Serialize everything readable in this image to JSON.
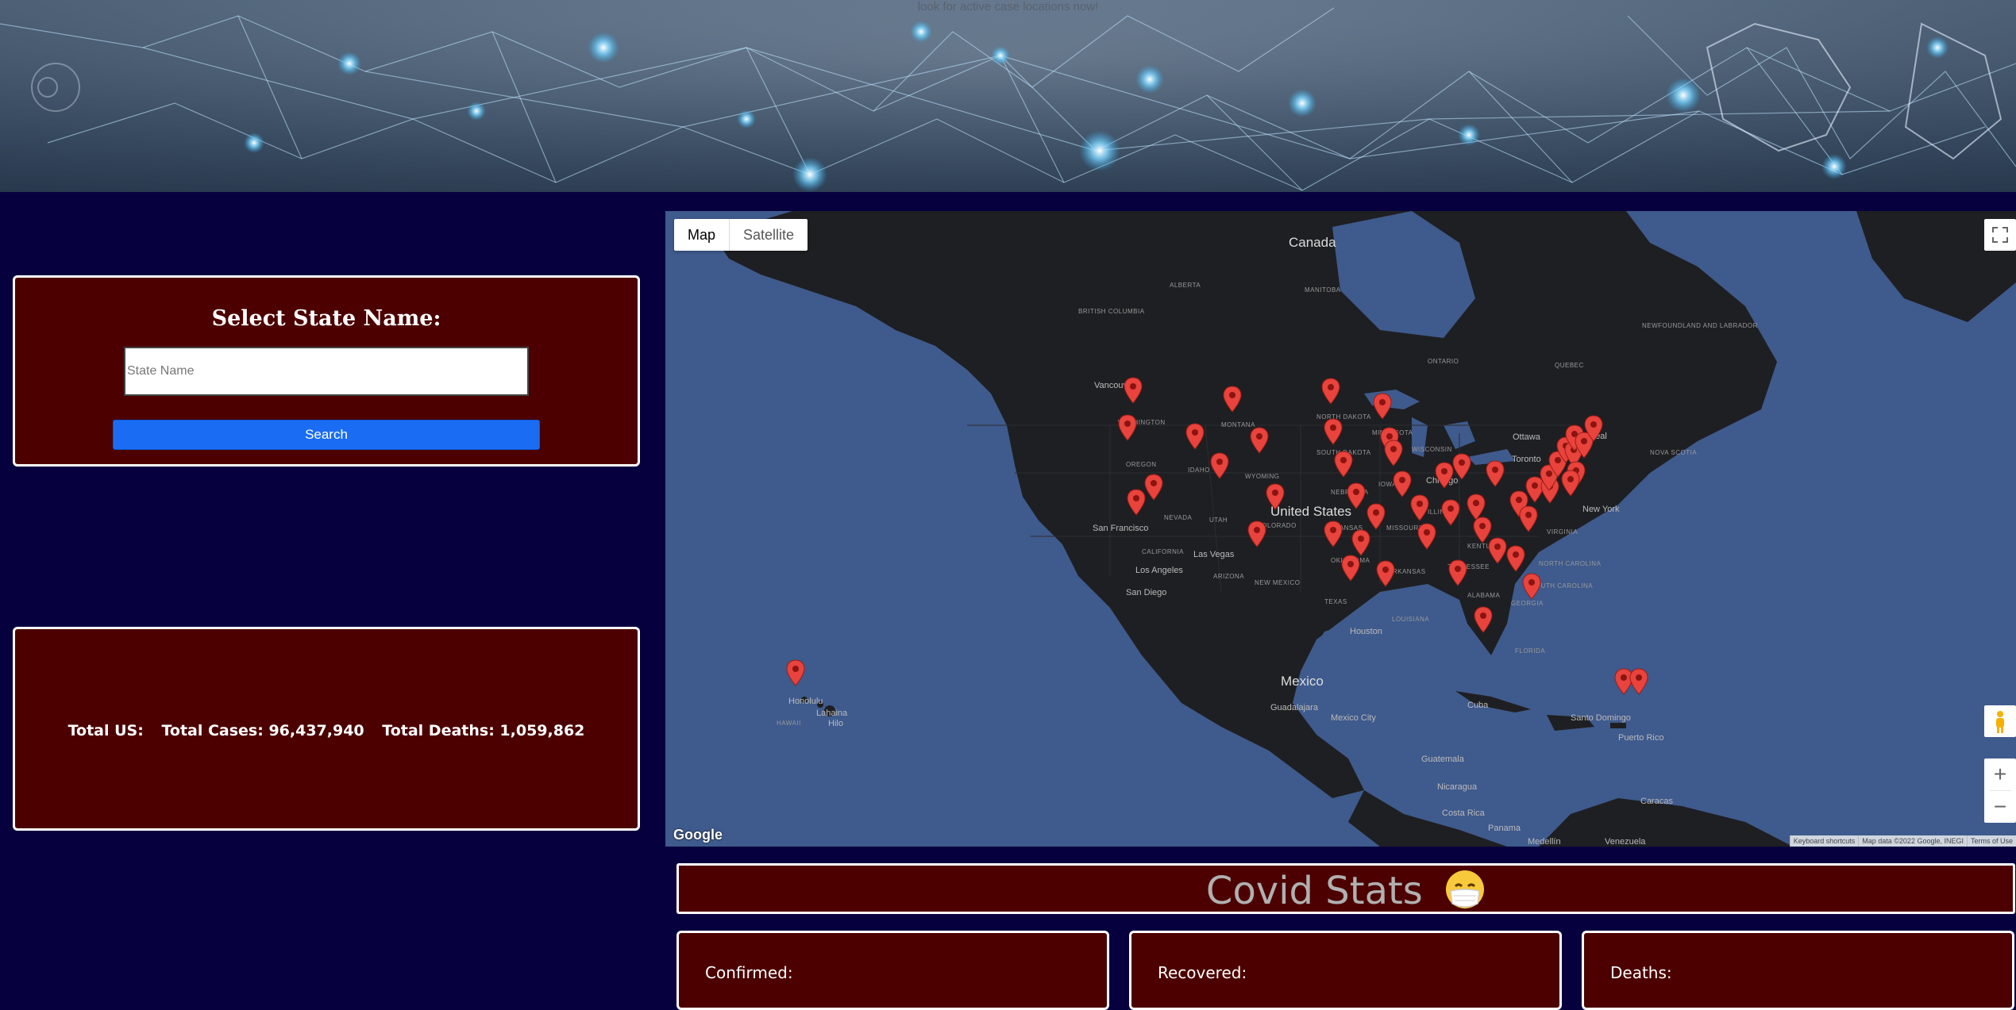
{
  "hero": {
    "tagline": "look for active case locations now!"
  },
  "search_panel": {
    "title": "Select State Name:",
    "input_placeholder": "State Name",
    "input_value": "",
    "search_label": "Search"
  },
  "totals": {
    "label": "Total US:",
    "cases": "Total Cases: 96,437,940",
    "deaths": "Total Deaths: 1,059,862"
  },
  "map": {
    "type_map": "Map",
    "type_satellite": "Satellite",
    "google": "Google",
    "attribution": [
      "Keyboard shortcuts",
      "Map data ©2022 Google, INEGI",
      "Terms of Use"
    ],
    "labels": {
      "canada": "Canada",
      "us": "United States",
      "mexico": "Mexico",
      "vancouver": "Vancouver",
      "sf": "San Francisco",
      "la": "Los Angeles",
      "sd": "San Diego",
      "lv": "Las Vegas",
      "houston": "Houston",
      "toronto": "Toronto",
      "ottawa": "Ottawa",
      "montreal": "Montreal",
      "ny": "New York",
      "chicago": "Chicago",
      "cuba": "Cuba",
      "pr": "Puerto Rico",
      "sto": "Santo Domingo",
      "guatemala": "Guatemala",
      "nicaragua": "Nicaragua",
      "costa": "Costa Rica",
      "panama": "Panama",
      "caracas": "Caracas",
      "venezuela": "Venezuela",
      "medellin": "Medellín",
      "guadalajara": "Guadalajara",
      "mexcity": "Mexico City",
      "honolulu": "Honolulu",
      "lahaina": "Lahaina",
      "hilo": "Hilo",
      "hawaii": "HAWAII",
      "alberta": "ALBERTA",
      "manitoba": "MANITOBA",
      "ontario": "ONTARIO",
      "quebec": "QUEBEC",
      "bc": "BRITISH COLUMBIA",
      "washington": "WASHINGTON",
      "oregon": "OREGON",
      "idaho": "IDAHO",
      "montana": "MONTANA",
      "wyoming": "WYOMING",
      "utah": "UTAH",
      "colorado": "COLORADO",
      "california": "CALIFORNIA",
      "arizona": "ARIZONA",
      "newmexico": "NEW MEXICO",
      "texas": "TEXAS",
      "kansas": "KANSAS",
      "oklahoma": "OKLAHOMA",
      "nebraska": "NEBRASKA",
      "sdakota": "SOUTH DAKOTA",
      "ndakota": "NORTH DAKOTA",
      "minnesota": "MINNESOTA",
      "iowa": "IOWA",
      "missouri": "MISSOURI",
      "arkansas": "ARKANSAS",
      "louisiana": "LOUISIANA",
      "wisconsin": "WISCONSIN",
      "illinois": "ILLINOIS",
      "tennessee": "TENNESSEE",
      "kentucky": "KENTUCKY",
      "alabama": "ALABAMA",
      "georgia": "GEORGIA",
      "florida": "FLORIDA",
      "carolina": "NORTH CAROLINA",
      "scarolina": "SOUTH CAROLINA",
      "virginia": "VIRGINIA",
      "nevada": "NEVADA",
      "labrador": "NEWFOUNDLAND AND LABRADOR",
      "novascotia": "NOVA SCOTIA"
    }
  },
  "stats": {
    "title": "Covid Stats",
    "confirmed": "Confirmed:",
    "recovered": "Recovered:",
    "deaths": "Deaths:"
  },
  "colors": {
    "page_bg": "#07003f",
    "panel_bg": "#4c0000",
    "button": "#1a6df3",
    "pin": "#e8433c",
    "ocean": "#3f5a8c",
    "land": "#1e1f22"
  },
  "icons": [
    "fullscreen-icon",
    "pegman-icon",
    "zoom-in-icon",
    "zoom-out-icon",
    "map-pin-icon",
    "mask-face-emoji"
  ]
}
